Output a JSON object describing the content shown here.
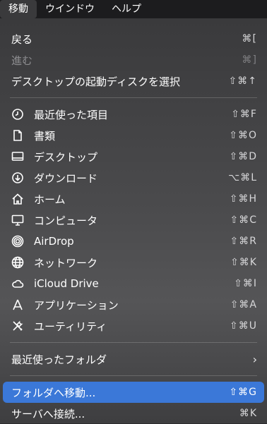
{
  "menubar": {
    "items": [
      "移動",
      "ウインドウ",
      "ヘルプ"
    ]
  },
  "menu": {
    "back": {
      "label": "戻る",
      "shortcut": "⌘["
    },
    "forward": {
      "label": "進む",
      "shortcut": "⌘]"
    },
    "startup": {
      "label": "デスクトップの起動ディスクを選択",
      "shortcut": "⇧⌘↑"
    },
    "places": [
      {
        "icon": "clock-icon",
        "label": "最近使った項目",
        "shortcut": "⇧⌘F"
      },
      {
        "icon": "document-icon",
        "label": "書類",
        "shortcut": "⇧⌘O"
      },
      {
        "icon": "desktop-icon",
        "label": "デスクトップ",
        "shortcut": "⇧⌘D"
      },
      {
        "icon": "download-icon",
        "label": "ダウンロード",
        "shortcut": "⌥⌘L"
      },
      {
        "icon": "home-icon",
        "label": "ホーム",
        "shortcut": "⇧⌘H"
      },
      {
        "icon": "computer-icon",
        "label": "コンピュータ",
        "shortcut": "⇧⌘C"
      },
      {
        "icon": "airdrop-icon",
        "label": "AirDrop",
        "shortcut": "⇧⌘R"
      },
      {
        "icon": "network-icon",
        "label": "ネットワーク",
        "shortcut": "⇧⌘K"
      },
      {
        "icon": "icloud-icon",
        "label": "iCloud Drive",
        "shortcut": "⇧⌘I"
      },
      {
        "icon": "applications-icon",
        "label": "アプリケーション",
        "shortcut": "⇧⌘A"
      },
      {
        "icon": "utilities-icon",
        "label": "ユーティリティ",
        "shortcut": "⇧⌘U"
      }
    ],
    "recent_folders": {
      "label": "最近使ったフォルダ",
      "chevron": "›"
    },
    "goto_folder": {
      "label": "フォルダへ移動...",
      "shortcut": "⇧⌘G"
    },
    "connect_server": {
      "label": "サーバへ接続...",
      "shortcut": "⌘K"
    }
  },
  "colors": {
    "selection": "#3b78d8"
  }
}
